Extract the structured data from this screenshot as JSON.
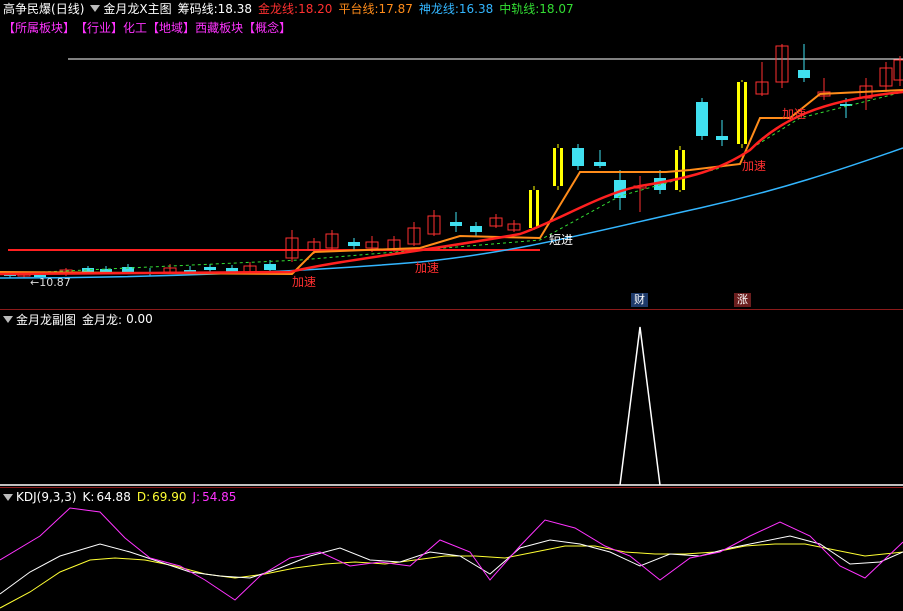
{
  "header": {
    "stock_name": "高争民爆",
    "period": "(日线)",
    "main_indicator": "金月龙X主图",
    "lines": [
      {
        "label": "筹码线:",
        "value": "18.38",
        "color": "#ffffff"
      },
      {
        "label": "金龙线:",
        "value": "18.20",
        "color": "#ff3030"
      },
      {
        "label": "平台线:",
        "value": "17.87",
        "color": "#ff8c1a"
      },
      {
        "label": "神龙线:",
        "value": "16.38",
        "color": "#33b6ff"
      },
      {
        "label": "中轨线:",
        "value": "18.07",
        "color": "#33dd33"
      }
    ]
  },
  "tags": {
    "items": [
      "【所属板块】",
      "【行业】",
      "化工",
      "【地域】",
      "西藏板块",
      "【概念】"
    ],
    "colors": [
      "#ff33ff",
      "#ff33ff",
      "#ff33ff",
      "#ff33ff",
      "#ff33ff",
      "#ff33ff"
    ]
  },
  "main_chart": {
    "low_label": "←10.87",
    "annotations": [
      "加速",
      "加速",
      "短进",
      "加速",
      "加速"
    ],
    "badges": [
      "财",
      "涨"
    ]
  },
  "sub_chart": {
    "title": "金月龙副图",
    "label": "金月龙:",
    "value": "0.00"
  },
  "kdj": {
    "title": "KDJ(9,3,3)",
    "k_label": "K:",
    "k_value": "64.88",
    "d_label": "D:",
    "d_value": "69.90",
    "j_label": "J:",
    "j_value": "54.85",
    "colors": {
      "k": "#ffffff",
      "d": "#ffff33",
      "j": "#ff33ff"
    }
  },
  "colors": {
    "up_candle": "#ff3030",
    "down_candle": "#40e0f0",
    "gold_bar": "#ffff00",
    "divider": "#8b1a1a"
  }
}
